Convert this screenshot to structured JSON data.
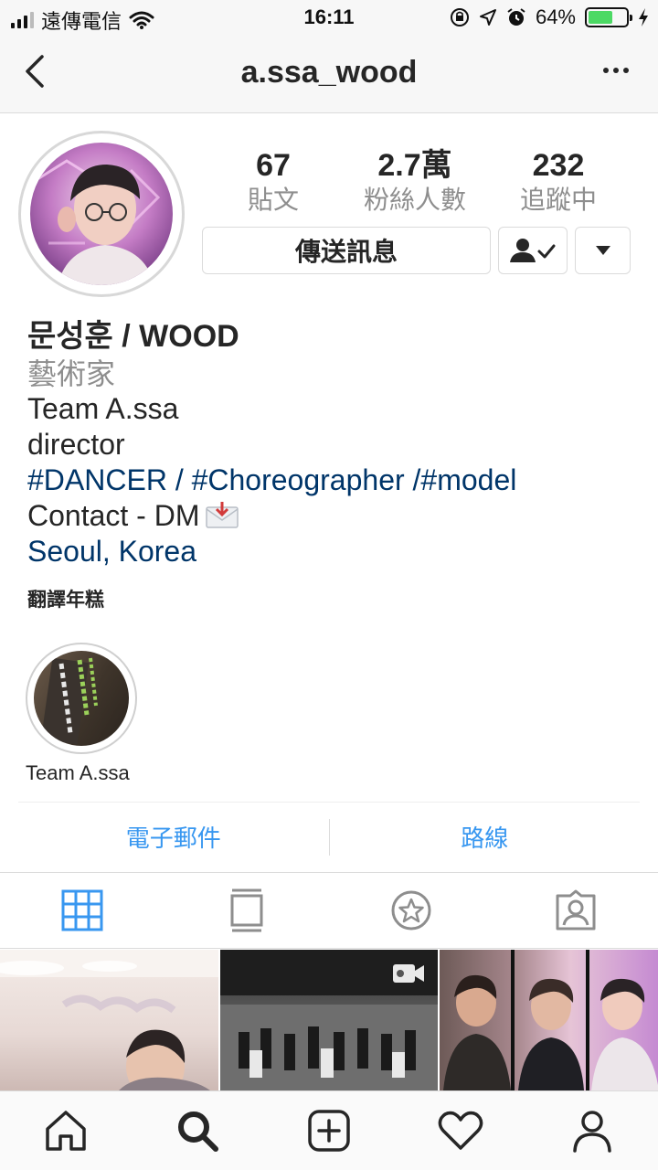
{
  "status_bar": {
    "carrier": "遠傳電信",
    "time": "16:11",
    "battery_percent": "64%",
    "battery_level": 0.64,
    "battery_color": "#4cd964"
  },
  "nav": {
    "title": "a.ssa_wood",
    "back_icon": "chevron-left-icon",
    "more_icon": "more-horizontal-icon"
  },
  "profile": {
    "stats": [
      {
        "value": "67",
        "label": "貼文"
      },
      {
        "value": "2.7萬",
        "label": "粉絲人數"
      },
      {
        "value": "232",
        "label": "追蹤中"
      }
    ],
    "message_button": "傳送訊息",
    "following_icon": "person-check-icon",
    "dropdown_icon": "caret-down-icon"
  },
  "bio": {
    "name": "문성훈 / WOOD",
    "category": "藝術家",
    "lines": [
      "Team A.ssa",
      "director"
    ],
    "hashtags": "#DANCER / #Choreographer /#model",
    "contact": "Contact - DM",
    "contact_icon": "incoming-envelope-icon",
    "location": "Seoul, Korea",
    "translate": "翻譯年糕"
  },
  "highlight": {
    "label": "Team A.ssa"
  },
  "contact_row": {
    "email": "電子郵件",
    "directions": "路線"
  },
  "tabs": [
    {
      "icon": "grid-icon",
      "active": true
    },
    {
      "icon": "feed-list-icon",
      "active": false
    },
    {
      "icon": "star-circle-icon",
      "active": false
    },
    {
      "icon": "tagged-person-icon",
      "active": false
    }
  ],
  "colors": {
    "link_blue": "#3897f0",
    "hashtag_blue": "#003569",
    "secondary_gray": "#8e8e8e"
  },
  "bottom_nav": [
    {
      "icon": "home-icon"
    },
    {
      "icon": "search-icon"
    },
    {
      "icon": "add-post-icon"
    },
    {
      "icon": "heart-icon"
    },
    {
      "icon": "profile-icon"
    }
  ]
}
